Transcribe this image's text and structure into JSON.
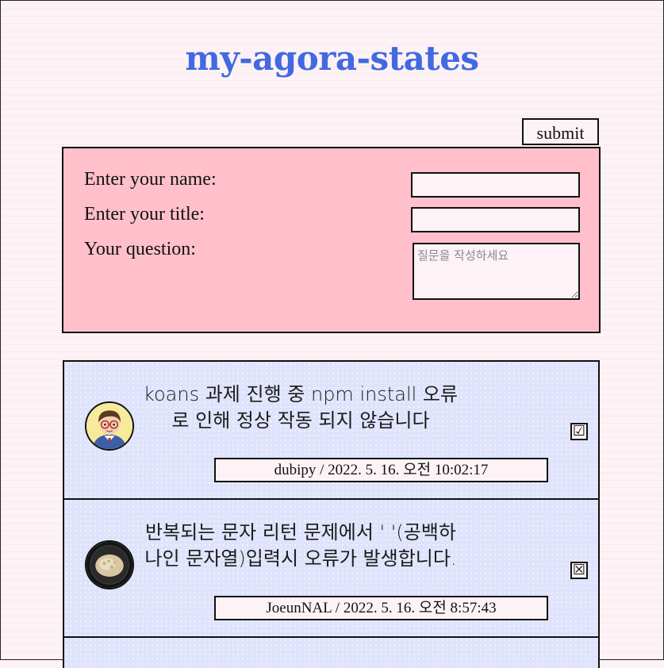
{
  "app": {
    "title": "my-agora-states"
  },
  "form": {
    "submit_label": "submit",
    "name_label": "Enter your name:",
    "title_label": "Enter your title:",
    "question_label": "Your question:",
    "name_value": "",
    "title_value": "",
    "question_placeholder": "질문을 작성하세요"
  },
  "discussions": [
    {
      "title": "koans 과제 진행 중 npm install 오류로 인해 정상 작동 되지 않습니다",
      "meta": "dubipy / 2022. 5. 16. 오전 10:02:17",
      "avatar_icon": "boy-with-glasses-avatar-icon",
      "answered_symbol": "☑",
      "answered": true
    },
    {
      "title": "반복되는 문자 리턴 문제에서 ' '(공백하나인 문자열)입력시 오류가 발생합니다.",
      "meta": "JoeunNAL / 2022. 5. 16. 오전 8:57:43",
      "avatar_icon": "food-bowl-avatar-icon",
      "answered_symbol": "☒",
      "answered": false
    },
    {
      "title": "",
      "meta": "",
      "avatar_icon": "",
      "answered_symbol": "",
      "answered": false
    }
  ],
  "colors": {
    "title": "#4169e1",
    "form_background": "#ffc0cb",
    "page_background": "#fdf2f6",
    "card_background": "#dfe3fb"
  }
}
